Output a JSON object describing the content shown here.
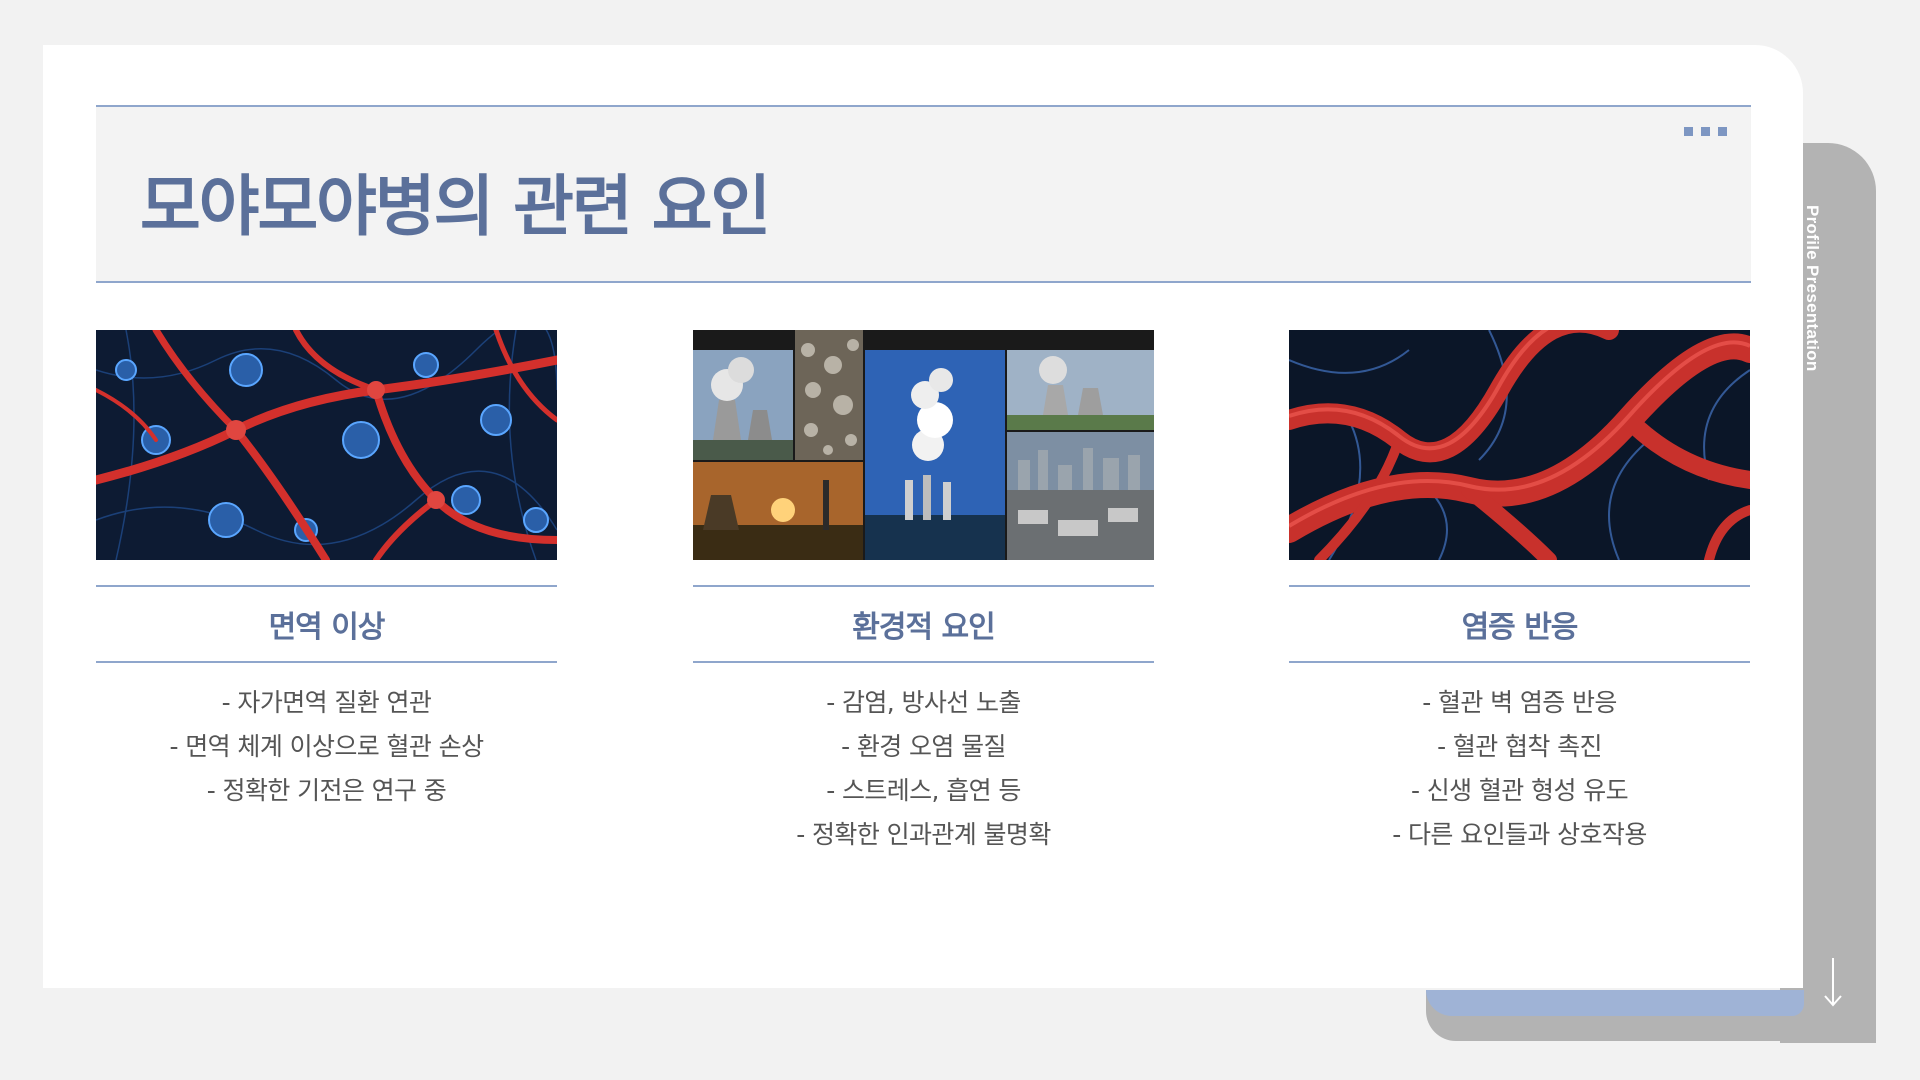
{
  "side_label": "Profile Presentation",
  "title": "모야모야병의 관련 요인",
  "colors": {
    "accent": "#8fa6cc",
    "title_text": "#5b709a",
    "body_text": "#555555",
    "side_gray": "#b3b3b3",
    "fold_blue": "#9fb3d6"
  },
  "columns": [
    {
      "title": "면역 이상",
      "image": "blood-vessels-cells-illustration",
      "bullets": [
        "- 자가면역 질환 연관",
        "- 면역 체계 이상으로 혈관 손상",
        "- 정확한 기전은 연구 중"
      ]
    },
    {
      "title": "환경적 요인",
      "image": "industrial-pollution-collage",
      "bullets": [
        "- 감염, 방사선 노출",
        "- 환경 오염 물질",
        "- 스트레스, 흡연 등",
        "- 정확한 인과관계 불명확"
      ]
    },
    {
      "title": "염증 반응",
      "image": "inflamed-blood-vessels-illustration",
      "bullets": [
        "- 혈관 벽 염증 반응",
        "- 혈관 협착 촉진",
        "- 신생 혈관 형성 유도",
        "- 다른 요인들과 상호작용"
      ]
    }
  ]
}
